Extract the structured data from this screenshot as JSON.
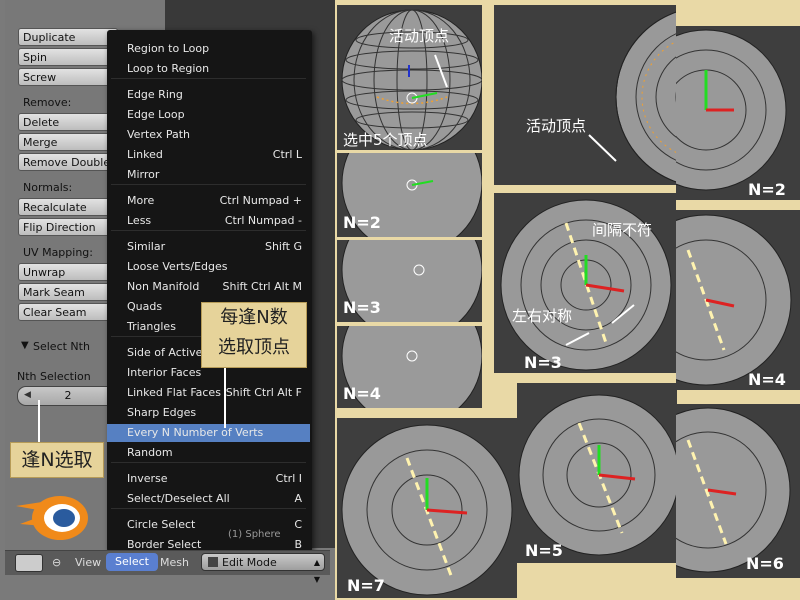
{
  "toolshelf": {
    "buttons": [
      "Duplicate",
      "Spin",
      "Screw"
    ],
    "remove_label": "Remove:",
    "remove_buttons": [
      "Delete",
      "Merge",
      "Remove Doubles"
    ],
    "normals_label": "Normals:",
    "normals_buttons": [
      "Recalculate",
      "Flip Direction"
    ],
    "uv_label": "UV Mapping:",
    "uv_buttons": [
      "Unwrap",
      "Mark Seam",
      "Clear Seam"
    ],
    "select_nth_header": "Select Nth",
    "nth_selection_label": "Nth Selection",
    "nth_value": "2"
  },
  "menu": {
    "items": [
      {
        "label": "Region to Loop",
        "shortcut": ""
      },
      {
        "label": "Loop to Region",
        "shortcut": ""
      },
      {
        "label": "Edge Ring",
        "shortcut": ""
      },
      {
        "label": "Edge Loop",
        "shortcut": ""
      },
      {
        "label": "Vertex Path",
        "shortcut": ""
      },
      {
        "label": "Linked",
        "shortcut": "Ctrl L"
      },
      {
        "label": "Mirror",
        "shortcut": ""
      },
      {
        "label": "More",
        "shortcut": "Ctrl Numpad +"
      },
      {
        "label": "Less",
        "shortcut": "Ctrl Numpad -"
      },
      {
        "label": "Similar",
        "shortcut": "Shift G"
      },
      {
        "label": "Loose Verts/Edges",
        "shortcut": ""
      },
      {
        "label": "Non Manifold",
        "shortcut": "Shift Ctrl Alt M"
      },
      {
        "label": "Quads",
        "shortcut": ""
      },
      {
        "label": "Triangles",
        "shortcut": ""
      },
      {
        "label": "Side of Active",
        "shortcut": ""
      },
      {
        "label": "Interior Faces",
        "shortcut": ""
      },
      {
        "label": "Linked Flat Faces",
        "shortcut": "Shift Ctrl Alt F"
      },
      {
        "label": "Sharp Edges",
        "shortcut": ""
      },
      {
        "label": "Every N Number of Verts",
        "shortcut": ""
      },
      {
        "label": "Random",
        "shortcut": ""
      },
      {
        "label": "Inverse",
        "shortcut": "Ctrl I"
      },
      {
        "label": "Select/Deselect All",
        "shortcut": "A"
      },
      {
        "label": "Circle Select",
        "shortcut": "C"
      },
      {
        "label": "Border Select",
        "shortcut": "B"
      }
    ],
    "highlighted": "Every N Number of Verts"
  },
  "statusbar": {
    "view": "View",
    "select": "Select",
    "mesh": "Mesh",
    "mode": "Edit Mode",
    "object_label": "(1) Sphere"
  },
  "annotations": {
    "every_n": "逢N选取",
    "menu_callout": [
      "每逢N数",
      "选取顶点"
    ],
    "active_vertex": "活动顶点",
    "five_selected": "选中5个顶点",
    "interval_mismatch": "间隔不符",
    "symmetric": "左右对称"
  },
  "tiles": {
    "n2": "N=2",
    "n2b": "N=2",
    "n3": "N=3",
    "n3b": "N=3",
    "n4": "N=4",
    "n4b": "N=4",
    "n5": "N=5",
    "n6": "N=6",
    "n7": "N=7"
  },
  "colors": {
    "highlight": "#5680c2",
    "callout": "#e6d39a",
    "selected_vertex": "#f0a030"
  }
}
